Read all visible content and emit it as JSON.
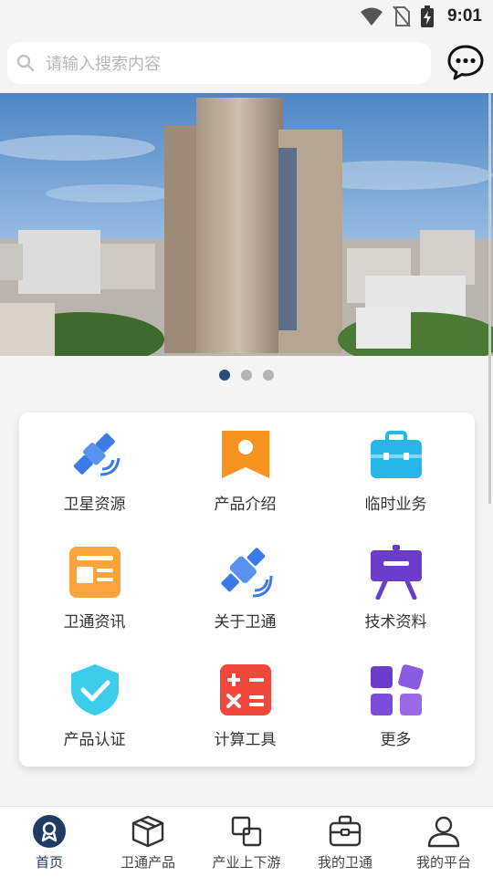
{
  "status_bar": {
    "time": "9:01"
  },
  "search": {
    "placeholder": "请输入搜索内容"
  },
  "banner": {
    "active_index": 0,
    "total": 3
  },
  "grid": [
    {
      "label": "卫星资源",
      "icon": "satellite-icon"
    },
    {
      "label": "产品介绍",
      "icon": "product-tag-icon"
    },
    {
      "label": "临时业务",
      "icon": "briefcase-icon"
    },
    {
      "label": "卫通资讯",
      "icon": "news-icon"
    },
    {
      "label": "关于卫通",
      "icon": "satellite-about-icon"
    },
    {
      "label": "技术资料",
      "icon": "easel-icon"
    },
    {
      "label": "产品认证",
      "icon": "shield-check-icon"
    },
    {
      "label": "计算工具",
      "icon": "calculator-icon"
    },
    {
      "label": "更多",
      "icon": "more-grid-icon"
    }
  ],
  "tabs": [
    {
      "label": "首页",
      "icon": "home-badge-icon",
      "active": true
    },
    {
      "label": "卫通产品",
      "icon": "cube-icon",
      "active": false
    },
    {
      "label": "产业上下游",
      "icon": "chain-squares-icon",
      "active": false
    },
    {
      "label": "我的卫通",
      "icon": "toolbox-icon",
      "active": false
    },
    {
      "label": "我的平台",
      "icon": "user-icon",
      "active": false
    }
  ],
  "colors": {
    "accent": "#1f3c66",
    "page_bg": "#f5f5f5",
    "blue": "#3b7be8",
    "orange": "#f7931e",
    "cyan": "#26b6e8",
    "purple": "#6a3cc9",
    "red": "#f0483a"
  }
}
